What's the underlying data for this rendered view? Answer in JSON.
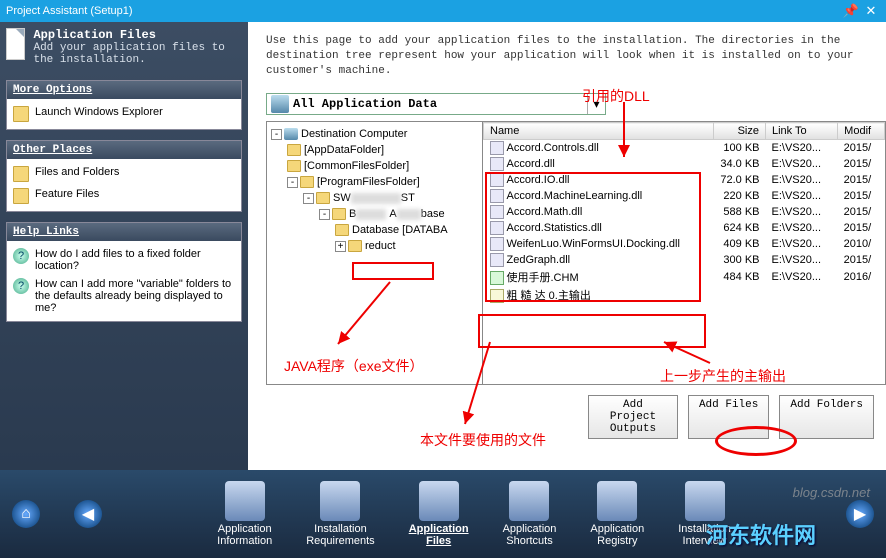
{
  "window": {
    "title": "Project Assistant (Setup1)"
  },
  "intro": {
    "heading": "Application Files",
    "text": "Add your application files to the installation."
  },
  "panels": {
    "more_options": {
      "title": "More Options",
      "items": [
        "Launch Windows Explorer"
      ]
    },
    "other_places": {
      "title": "Other Places",
      "items": [
        "Files and Folders",
        "Feature Files"
      ]
    },
    "help_links": {
      "title": "Help Links",
      "items": [
        "How do I add files to a fixed folder location?",
        "How can I add more \"variable\" folders to the defaults already being displayed to me?"
      ]
    }
  },
  "help_text": "Use this page to add your application files to the installation. The directories in the destination tree represent how your application will look when it is installed on to your customer's machine.",
  "dropdown": {
    "label": "All Application Data"
  },
  "tree": {
    "root": "Destination Computer",
    "nodes": [
      "[AppDataFolder]",
      "[CommonFilesFolder]",
      "[ProgramFilesFolder]"
    ],
    "sub": {
      "sw": "SW",
      "st": "ST",
      "blurred": "B",
      "blurred2": "A",
      "blurred3": "base",
      "database": "Database  [DATABA",
      "reduct": "reduct"
    }
  },
  "file_table": {
    "columns": [
      "Name",
      "Size",
      "Link To",
      "Modif"
    ],
    "rows": [
      {
        "name": "Accord.Controls.dll",
        "size": "100 KB",
        "link": "E:\\VS20...",
        "mod": "2015/",
        "type": "dll"
      },
      {
        "name": "Accord.dll",
        "size": "34.0 KB",
        "link": "E:\\VS20...",
        "mod": "2015/",
        "type": "dll"
      },
      {
        "name": "Accord.IO.dll",
        "size": "72.0 KB",
        "link": "E:\\VS20...",
        "mod": "2015/",
        "type": "dll"
      },
      {
        "name": "Accord.MachineLearning.dll",
        "size": "220 KB",
        "link": "E:\\VS20...",
        "mod": "2015/",
        "type": "dll"
      },
      {
        "name": "Accord.Math.dll",
        "size": "588 KB",
        "link": "E:\\VS20...",
        "mod": "2015/",
        "type": "dll"
      },
      {
        "name": "Accord.Statistics.dll",
        "size": "624 KB",
        "link": "E:\\VS20...",
        "mod": "2015/",
        "type": "dll"
      },
      {
        "name": "WeifenLuo.WinFormsUI.Docking.dll",
        "size": "409 KB",
        "link": "E:\\VS20...",
        "mod": "2010/",
        "type": "dll"
      },
      {
        "name": "ZedGraph.dll",
        "size": "300 KB",
        "link": "E:\\VS20...",
        "mod": "2015/",
        "type": "dll"
      },
      {
        "name": "使用手册.CHM",
        "size": "484 KB",
        "link": "E:\\VS20...",
        "mod": "2016/",
        "type": "chm"
      },
      {
        "name": "粗     糙    达       0.主输出",
        "size": "",
        "link": "",
        "mod": "",
        "type": "exe"
      }
    ]
  },
  "buttons": {
    "add_outputs": "Add Project Outputs",
    "add_files": "Add Files",
    "add_folders": "Add Folders"
  },
  "steps": [
    "Application Information",
    "Installation Requirements",
    "Application Files",
    "Application Shortcuts",
    "Application Registry",
    "Installation Interview"
  ],
  "annotations": {
    "dll_label": "引用的DLL",
    "java_label": "JAVA程序（exe文件）",
    "use_file_label": "本文件要使用的文件",
    "output_label": "上一步产生的主输出"
  },
  "watermark": "blog.csdn.net",
  "brand": "河东软件网"
}
